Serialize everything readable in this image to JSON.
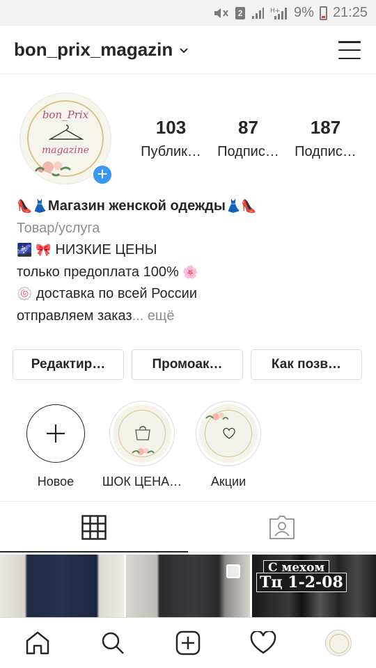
{
  "status_bar": {
    "sim": "2",
    "battery": "9%",
    "time": "21:25"
  },
  "header": {
    "username": "bon_prix_magazin",
    "chevron": "⌄"
  },
  "profile": {
    "avatar_text_top": "bon_Prix",
    "avatar_text_bottom": "magazine",
    "add_badge": "+",
    "stats": [
      {
        "value": "103",
        "label": "Публик…"
      },
      {
        "value": "87",
        "label": "Подпис…"
      },
      {
        "value": "187",
        "label": "Подпис…"
      }
    ]
  },
  "bio": {
    "name_emoji_left": "👠👗",
    "name": "Магазин женской одежды",
    "name_emoji_right": "👗👠",
    "category": "Товар/услуга",
    "line1_emoji": "🌌  🎀",
    "line1_text": "НИЗКИЕ ЦЕНЫ",
    "line2_text": "только предоплата 100%",
    "line2_emoji": "🌸",
    "line3_emoji": "🍥",
    "line3_text": "доставка по всей России",
    "line4_text": "отправляем заказ",
    "line4_more": "... ещё"
  },
  "buttons": [
    {
      "label": "Редактир…"
    },
    {
      "label": "Промоак…"
    },
    {
      "label": "Как позв…"
    }
  ],
  "highlights": [
    {
      "label": "Новое",
      "icon": "plus-icon"
    },
    {
      "label": "ШОК ЦЕНА…",
      "icon": "shopping-bag-icon"
    },
    {
      "label": "Акции",
      "icon": "heart-icon"
    }
  ],
  "tabs": [
    {
      "name": "grid",
      "icon": "grid-icon",
      "active": true
    },
    {
      "name": "tagged",
      "icon": "tagged-person-icon",
      "active": false
    }
  ],
  "grid_posts": [
    {
      "label_1": "",
      "label_2": ""
    },
    {
      "label_1": "",
      "label_2": ""
    },
    {
      "label_1": "С мехом",
      "label_2": "Тц 1-2-08"
    }
  ],
  "bottom_nav": [
    "home-icon",
    "search-icon",
    "add-post-icon",
    "heart-icon",
    "profile-avatar"
  ],
  "colors": {
    "accent_blue": "#3897f0",
    "text": "#262626",
    "secondary": "#8e8e8e",
    "border": "#dbdbdb",
    "gold": "#d8c38a"
  }
}
